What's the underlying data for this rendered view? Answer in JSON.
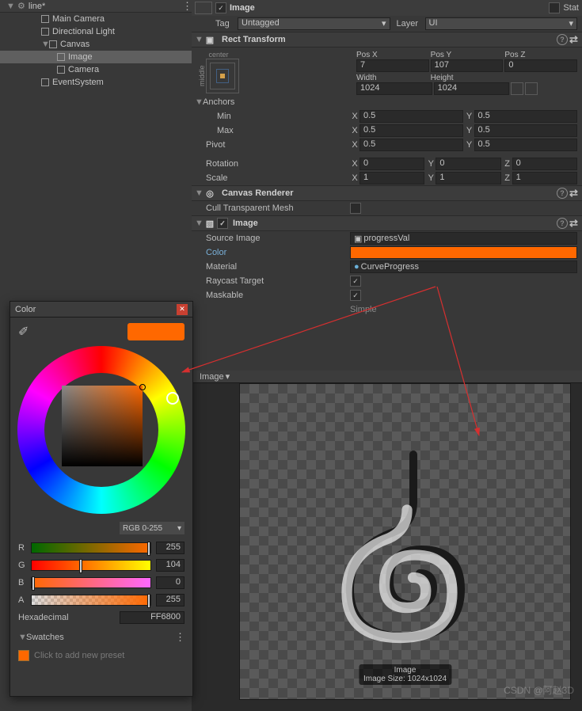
{
  "hierarchy": {
    "scene": "line*",
    "items": [
      "Main Camera",
      "Directional Light",
      "Canvas",
      "Image",
      "Camera",
      "EventSystem"
    ]
  },
  "header": {
    "name": "Image",
    "tag_label": "Tag",
    "tag_value": "Untagged",
    "layer_label": "Layer",
    "layer_value": "UI",
    "static_label": "Stat"
  },
  "rect": {
    "title": "Rect Transform",
    "anchor_preset_top": "center",
    "anchor_preset_side": "middle",
    "posx_label": "Pos X",
    "posx": "7",
    "posy_label": "Pos Y",
    "posy": "107",
    "posz_label": "Pos Z",
    "posz": "0",
    "width_label": "Width",
    "width": "1024",
    "height_label": "Height",
    "height": "1024",
    "anchors_label": "Anchors",
    "min_label": "Min",
    "min_x": "0.5",
    "min_y": "0.5",
    "max_label": "Max",
    "max_x": "0.5",
    "max_y": "0.5",
    "pivot_label": "Pivot",
    "pivot_x": "0.5",
    "pivot_y": "0.5",
    "rotation_label": "Rotation",
    "rot_x": "0",
    "rot_y": "0",
    "rot_z": "0",
    "scale_label": "Scale",
    "scale_x": "1",
    "scale_y": "1",
    "scale_z": "1"
  },
  "canvas_renderer": {
    "title": "Canvas Renderer",
    "cull_label": "Cull Transparent Mesh"
  },
  "image": {
    "title": "Image",
    "source_label": "Source Image",
    "source_value": "progressVal",
    "color_label": "Color",
    "color_hex": "#FF6800",
    "material_label": "Material",
    "material_value": "CurveProgress",
    "raycast_label": "Raycast Target",
    "maskable_label": "Maskable",
    "simple": "Simple"
  },
  "preview": {
    "tab": "Image",
    "footer_name": "Image",
    "footer_size": "Image Size: 1024x1024"
  },
  "colorwin": {
    "title": "Color",
    "mode": "RGB 0-255",
    "r_label": "R",
    "r": "255",
    "g_label": "G",
    "g": "104",
    "b_label": "B",
    "b": "0",
    "a_label": "A",
    "a": "255",
    "hex_label": "Hexadecimal",
    "hex": "FF6800",
    "swatches_label": "Swatches",
    "preset_label": "Click to add new preset"
  },
  "watermark": "CSDN @阿赵3D"
}
